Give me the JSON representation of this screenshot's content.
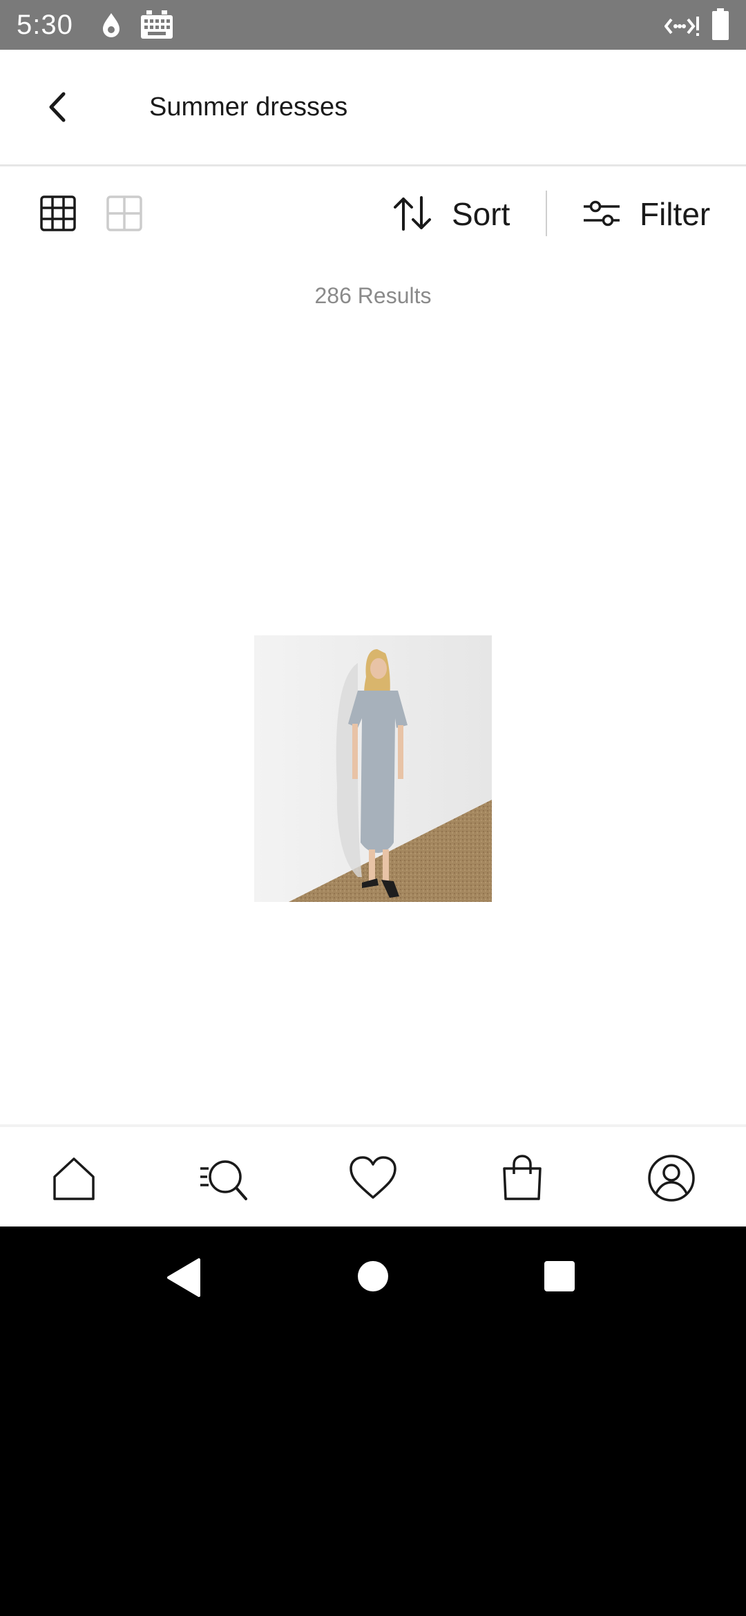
{
  "status": {
    "time": "5:30"
  },
  "header": {
    "title": "Summer dresses"
  },
  "toolbar": {
    "sort_label": "Sort",
    "filter_label": "Filter"
  },
  "results": {
    "count_text": "286 Results"
  },
  "colors": {
    "statusbar": "#7a7a7a",
    "icon_dark": "#1a1a1a",
    "icon_inactive": "#cccccc",
    "results_text": "#8a8a8a"
  },
  "icons": {
    "statusbar": [
      "data-drop-icon",
      "keyboard-icon",
      "wifi-calling-icon",
      "battery-icon"
    ],
    "toolbar": [
      "grid-3-icon",
      "grid-2-icon",
      "sort-arrows-icon",
      "filter-sliders-icon"
    ],
    "bottom_nav": [
      "home-icon",
      "search-icon",
      "heart-icon",
      "shopping-bag-icon",
      "account-icon"
    ],
    "system_nav": [
      "back-triangle-icon",
      "home-circle-icon",
      "recents-square-icon"
    ]
  }
}
